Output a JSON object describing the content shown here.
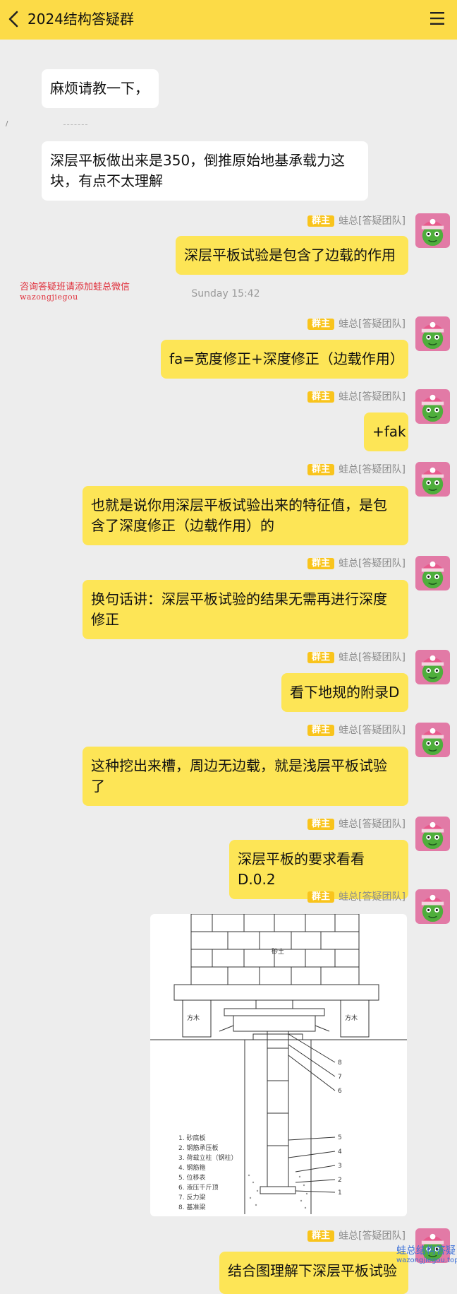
{
  "header": {
    "title": "2024结构答疑群"
  },
  "messages_in": [
    {
      "text": "麻烦请教一下，"
    },
    {
      "text": "深层平板做出来是350，倒推原始地基承载力这块，有点不太理解"
    }
  ],
  "timestamp": "Sunday 15:42",
  "sender": {
    "badge": "群主",
    "name": "蛙总[答疑团队]"
  },
  "messages_out": [
    {
      "text": "深层平板试验是包含了边载的作用"
    },
    {
      "text": "fa=宽度修正+深度修正（边载作用）"
    },
    {
      "text": "+fak"
    },
    {
      "text": "也就是说你用深层平板试验出来的特征值，是包含了深度修正（边载作用）的"
    },
    {
      "text": "换句话讲：深层平板试验的结果无需再进行深度修正"
    },
    {
      "text": "看下地规的附录D"
    },
    {
      "text": "这种挖出来槽，周边无边载，就是浅层平板试验了"
    },
    {
      "text": "深层平板的要求看看D.0.2"
    },
    {
      "text": "结合图理解下深层平板试验"
    }
  ],
  "diagram": {
    "center_label": "砂土",
    "left_label": "方木",
    "right_label": "方木",
    "legend": [
      "1. 砂底板",
      "2. 钢筋承压板",
      "3. 荷载立柱（钢柱）",
      "4. 钢筋箍",
      "5. 位移表",
      "6. 液压千斤顶",
      "7. 反力梁",
      "8. 基准梁"
    ],
    "callouts": [
      "8",
      "7",
      "6",
      "5",
      "4",
      "3",
      "2",
      "1"
    ]
  },
  "watermark_top": {
    "line1": "咨询答疑班请添加蛙总微信",
    "line2": "wazongjiegou"
  },
  "watermark_bottom": {
    "line1": "蛙总结构答疑",
    "line2": "wazongjiegou.top"
  },
  "colors": {
    "header": "#fcdb47",
    "bubble_out": "#fde556",
    "bubble_in": "#ffffff",
    "badge": "#f9c41c",
    "background": "#ededed"
  }
}
